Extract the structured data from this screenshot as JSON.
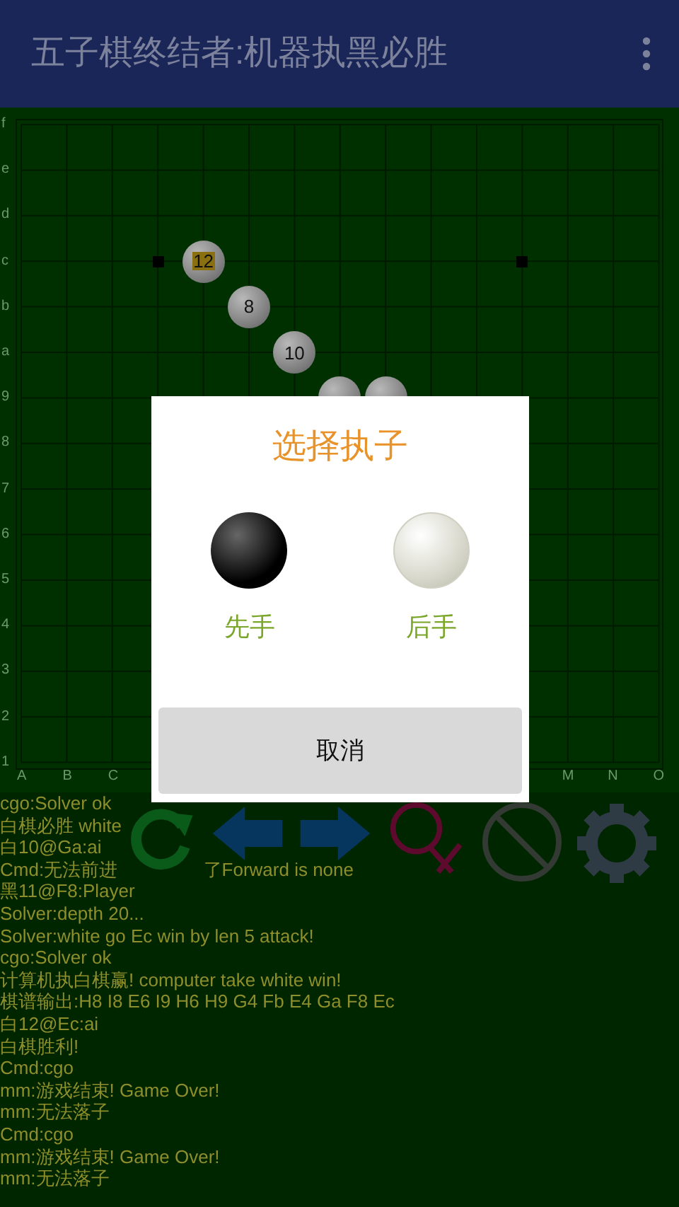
{
  "app_bar": {
    "title": "五子棋终结者:机器执黑必胜"
  },
  "board": {
    "rows": [
      {
        "label": "f",
        "points": [
          {
            "kind": "empty"
          },
          {
            "kind": "empty"
          },
          {
            "kind": "empty"
          },
          {
            "kind": "empty"
          },
          {
            "kind": "empty"
          },
          {
            "kind": "empty"
          },
          {
            "kind": "empty"
          },
          {
            "kind": "empty"
          },
          {
            "kind": "empty"
          },
          {
            "kind": "empty"
          },
          {
            "kind": "empty"
          },
          {
            "kind": "empty"
          },
          {
            "kind": "empty"
          },
          {
            "kind": "empty"
          },
          {
            "kind": "empty"
          }
        ]
      },
      {
        "label": "e",
        "points": [
          {
            "kind": "empty"
          },
          {
            "kind": "empty"
          },
          {
            "kind": "empty"
          },
          {
            "kind": "empty"
          },
          {
            "kind": "empty"
          },
          {
            "kind": "empty"
          },
          {
            "kind": "empty"
          },
          {
            "kind": "empty"
          },
          {
            "kind": "empty"
          },
          {
            "kind": "empty"
          },
          {
            "kind": "empty"
          },
          {
            "kind": "empty"
          },
          {
            "kind": "empty"
          },
          {
            "kind": "empty"
          },
          {
            "kind": "empty"
          }
        ]
      },
      {
        "label": "d",
        "points": [
          {
            "kind": "empty"
          },
          {
            "kind": "empty"
          },
          {
            "kind": "empty"
          },
          {
            "kind": "empty"
          },
          {
            "kind": "empty"
          },
          {
            "kind": "empty"
          },
          {
            "kind": "empty"
          },
          {
            "kind": "empty"
          },
          {
            "kind": "empty"
          },
          {
            "kind": "empty"
          },
          {
            "kind": "empty"
          },
          {
            "kind": "empty"
          },
          {
            "kind": "empty"
          },
          {
            "kind": "empty"
          },
          {
            "kind": "empty"
          }
        ]
      },
      {
        "label": "c",
        "points": [
          {
            "kind": "empty"
          },
          {
            "kind": "empty"
          },
          {
            "kind": "empty"
          },
          {
            "kind": "star"
          },
          {
            "kind": "white",
            "label": "12",
            "last": true
          },
          {
            "kind": "empty"
          },
          {
            "kind": "empty"
          },
          {
            "kind": "empty"
          },
          {
            "kind": "empty"
          },
          {
            "kind": "empty"
          },
          {
            "kind": "empty"
          },
          {
            "kind": "star"
          },
          {
            "kind": "empty"
          },
          {
            "kind": "empty"
          },
          {
            "kind": "empty"
          }
        ]
      },
      {
        "label": "b",
        "points": [
          {
            "kind": "empty"
          },
          {
            "kind": "empty"
          },
          {
            "kind": "empty"
          },
          {
            "kind": "empty"
          },
          {
            "kind": "empty"
          },
          {
            "kind": "white",
            "label": "8",
            "last": false
          },
          {
            "kind": "empty"
          },
          {
            "kind": "empty"
          },
          {
            "kind": "empty"
          },
          {
            "kind": "empty"
          },
          {
            "kind": "empty"
          },
          {
            "kind": "empty"
          },
          {
            "kind": "empty"
          },
          {
            "kind": "empty"
          },
          {
            "kind": "empty"
          }
        ]
      },
      {
        "label": "a",
        "points": [
          {
            "kind": "empty"
          },
          {
            "kind": "empty"
          },
          {
            "kind": "empty"
          },
          {
            "kind": "empty"
          },
          {
            "kind": "empty"
          },
          {
            "kind": "empty"
          },
          {
            "kind": "white",
            "label": "10",
            "last": false
          },
          {
            "kind": "empty"
          },
          {
            "kind": "empty"
          },
          {
            "kind": "empty"
          },
          {
            "kind": "empty"
          },
          {
            "kind": "empty"
          },
          {
            "kind": "empty"
          },
          {
            "kind": "empty"
          },
          {
            "kind": "empty"
          }
        ]
      },
      {
        "label": "9",
        "points": [
          {
            "kind": "empty"
          },
          {
            "kind": "empty"
          },
          {
            "kind": "empty"
          },
          {
            "kind": "empty"
          },
          {
            "kind": "empty"
          },
          {
            "kind": "empty"
          },
          {
            "kind": "empty"
          },
          {
            "kind": "white"
          },
          {
            "kind": "white"
          },
          {
            "kind": "empty"
          },
          {
            "kind": "empty"
          },
          {
            "kind": "empty"
          },
          {
            "kind": "empty"
          },
          {
            "kind": "empty"
          },
          {
            "kind": "empty"
          }
        ]
      },
      {
        "label": "8",
        "points": []
      },
      {
        "label": "7",
        "points": []
      },
      {
        "label": "6",
        "points": []
      },
      {
        "label": "5",
        "points": []
      },
      {
        "label": "4",
        "points": []
      },
      {
        "label": "3",
        "points": []
      },
      {
        "label": "2",
        "points": []
      },
      {
        "label": "1",
        "points": []
      }
    ],
    "col_labels_left": [
      "A",
      "B",
      "C"
    ],
    "col_labels_right": [
      "M",
      "N",
      "O"
    ]
  },
  "toolbar": [
    {
      "kind": "restart"
    },
    {
      "kind": "back"
    },
    {
      "kind": "forward"
    },
    {
      "kind": "search"
    },
    {
      "kind": "stop"
    },
    {
      "kind": "settings"
    }
  ],
  "log": [
    {
      "text": "cgo:Solver ok"
    },
    {
      "text": "白棋必胜 white"
    },
    {
      "text": "白10@Ga:ai"
    },
    {
      "text": "Cmd:无法前进",
      "tail": "了Forward is none"
    },
    {
      "text": "黑11@F8:Player"
    },
    {
      "text": "Solver:depth 20..."
    },
    {
      "text": "Solver:white go Ec win by len 5 attack!"
    },
    {
      "text": "cgo:Solver ok"
    },
    {
      "text": "计算机执白棋赢! computer take white win!"
    },
    {
      "text": "棋谱输出:H8 I8 E6 I9 H6 H9 G4 Fb E4 Ga F8 Ec"
    },
    {
      "text": "白12@Ec:ai"
    },
    {
      "text": "白棋胜利!"
    },
    {
      "text": "Cmd:cgo"
    },
    {
      "text": "mm:游戏结束! Game Over!"
    },
    {
      "text": "mm:无法落子"
    },
    {
      "text": "Cmd:cgo"
    },
    {
      "text": "mm:游戏结束! Game Over!"
    },
    {
      "text": "mm:无法落子"
    }
  ],
  "dialog": {
    "title": "选择执子",
    "options": [
      {
        "kind": "black",
        "label": "先手"
      },
      {
        "kind": "white",
        "label": "后手"
      }
    ],
    "cancel": "取消"
  }
}
